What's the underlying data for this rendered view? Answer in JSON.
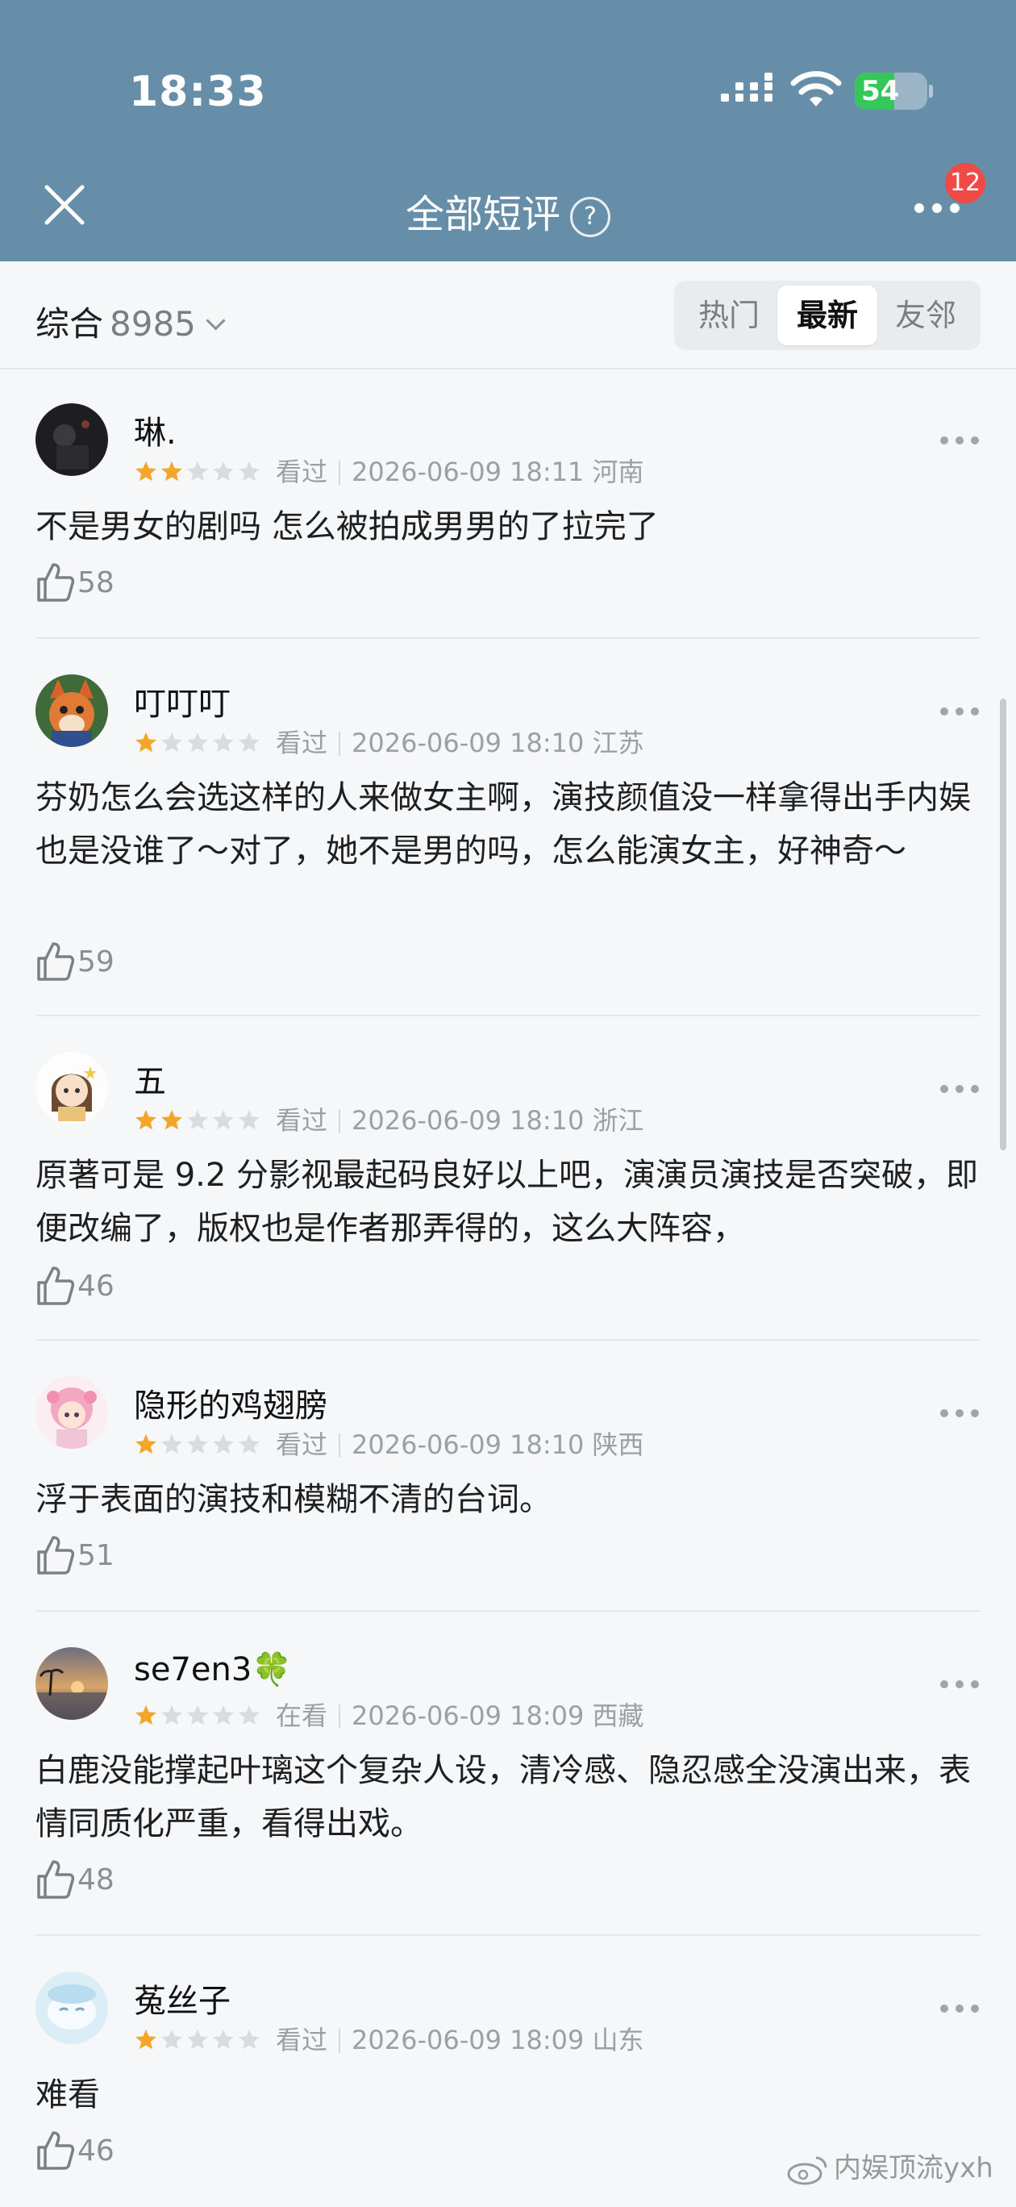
{
  "status_bar": {
    "time": "18:33",
    "battery_level": "54",
    "battery_fraction": 0.54
  },
  "nav": {
    "title": "全部短评",
    "help_glyph": "?",
    "notification_count": "12"
  },
  "filter": {
    "sort_label": "综合",
    "count": "8985",
    "tabs": [
      {
        "label": "热门",
        "active": false
      },
      {
        "label": "最新",
        "active": true
      },
      {
        "label": "友邻",
        "active": false
      }
    ]
  },
  "colors": {
    "header_bg": "#668ea9",
    "star_filled": "#f4a629",
    "star_empty": "#d9dcdf",
    "badge": "#ef4a45",
    "battery_fill": "#35c759"
  },
  "reviews": [
    {
      "user": "琳.",
      "rating": 2,
      "status": "看过",
      "datetime": "2026-06-09 18:11",
      "location": "河南",
      "text": "不是男女的剧吗 怎么被拍成男男的了拉完了",
      "likes": "58",
      "avatar_icon": "dark-night-avatar"
    },
    {
      "user": "叮叮叮",
      "rating": 1,
      "status": "看过",
      "datetime": "2026-06-09 18:10",
      "location": "江苏",
      "text": "芬奶怎么会选这样的人来做女主啊，演技颜值没一样拿得出手内娱也是没谁了～对了，她不是男的吗，怎么能演女主，好神奇～",
      "likes": "59",
      "avatar_icon": "fox-cartoon-avatar"
    },
    {
      "user": "五",
      "rating": 2,
      "status": "看过",
      "datetime": "2026-06-09 18:10",
      "location": "浙江",
      "text": "原著可是 9.2 分影视最起码良好以上吧，演演员演技是否突破，即便改编了，版权也是作者那弄得的，这么大阵容，",
      "likes": "46",
      "avatar_icon": "chibi-girl-avatar"
    },
    {
      "user": "隐形的鸡翅膀",
      "rating": 1,
      "status": "看过",
      "datetime": "2026-06-09 18:10",
      "location": "陕西",
      "text": "浮于表面的演技和模糊不清的台词。",
      "likes": "51",
      "avatar_icon": "pink-anime-avatar"
    },
    {
      "user": "se7en3🍀",
      "rating": 1,
      "status": "在看",
      "datetime": "2026-06-09 18:09",
      "location": "西藏",
      "text": "白鹿没能撑起叶璃这个复杂人设，清冷感、隐忍感全没演出来，表情同质化严重，看得出戏。",
      "likes": "48",
      "avatar_icon": "sunset-beach-avatar"
    },
    {
      "user": "菟丝子",
      "rating": 1,
      "status": "看过",
      "datetime": "2026-06-09 18:09",
      "location": "山东",
      "text": "难看",
      "likes": "46",
      "avatar_icon": "sleepy-anime-avatar"
    }
  ],
  "watermark": "内娱顶流yxh"
}
